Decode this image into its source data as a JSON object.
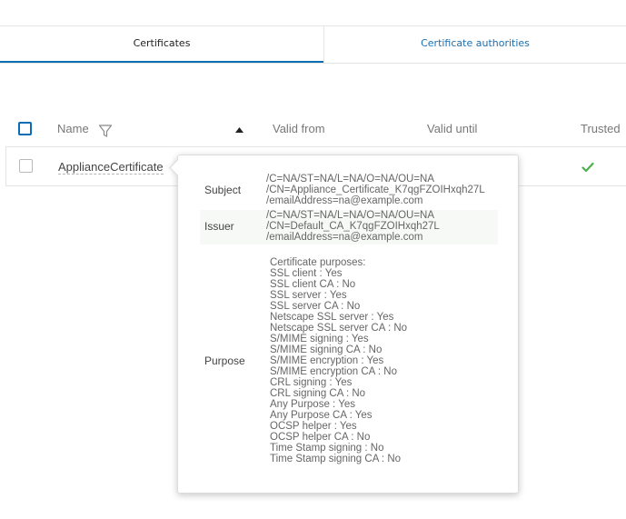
{
  "tabs": [
    {
      "label": "Certificates",
      "active": true
    },
    {
      "label": "Certificate authorities",
      "active": false
    }
  ],
  "table": {
    "columns": {
      "name": "Name",
      "valid_from": "Valid from",
      "valid_until": "Valid until",
      "trusted": "Trusted"
    },
    "sort": {
      "column": "name",
      "direction": "ascending"
    },
    "rows": [
      {
        "name": "ApplianceCertificate",
        "trusted": true
      }
    ]
  },
  "popover": {
    "subject": {
      "label": "Subject",
      "lines": [
        "/C=NA/ST=NA/L=NA/O=NA/OU=NA",
        "/CN=Appliance_Certificate_K7qgFZOIHxqh27L",
        "/emailAddress=na@example.com"
      ]
    },
    "issuer": {
      "label": "Issuer",
      "lines": [
        "/C=NA/ST=NA/L=NA/O=NA/OU=NA",
        "/CN=Default_CA_K7qgFZOIHxqh27L",
        "/emailAddress=na@example.com"
      ]
    },
    "purpose": {
      "label": "Purpose",
      "lines": [
        "Certificate purposes:",
        "SSL client : Yes",
        "SSL client CA : No",
        "SSL server : Yes",
        "SSL server CA : No",
        "Netscape SSL server : Yes",
        "Netscape SSL server CA : No",
        "S/MIME signing : Yes",
        "S/MIME signing CA : No",
        "S/MIME encryption : Yes",
        "S/MIME encryption CA : No",
        "CRL signing : Yes",
        "CRL signing CA : No",
        "Any Purpose : Yes",
        "Any Purpose CA : Yes",
        "OCSP helper : Yes",
        "OCSP helper CA : No",
        "Time Stamp signing : No",
        "Time Stamp signing CA : No"
      ]
    }
  },
  "colors": {
    "accent": "#0a6eb4",
    "link": "#1a6fb0",
    "trusted_check": "#4caf50"
  },
  "icons": {
    "filter": "filter-icon",
    "sort": "sort-ascending-icon",
    "trusted": "check-icon"
  }
}
